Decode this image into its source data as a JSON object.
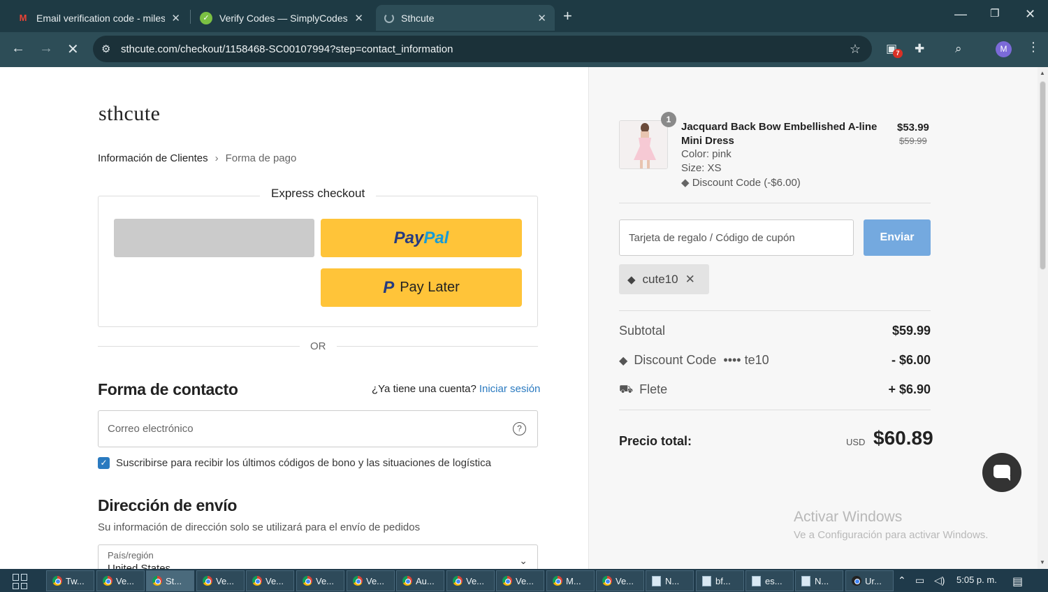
{
  "browser": {
    "tabs": [
      {
        "title": "Email verification code - milesm",
        "favicon": "gmail-icon"
      },
      {
        "title": "Verify Codes — SimplyCodes",
        "favicon": "simplycodes-icon"
      },
      {
        "title": "Sthcute",
        "favicon": "loading-icon",
        "active": true
      }
    ],
    "url": "sthcute.com/checkout/1158468-SC00107994?step=contact_information",
    "ext_badge": "7",
    "profile_initial": "M"
  },
  "checkout": {
    "logo": "sthcute",
    "breadcrumb": [
      "Información de Clientes",
      "Forma de pago"
    ],
    "express_title": "Express checkout",
    "paypal_label_a": "Pay",
    "paypal_label_b": "Pal",
    "paylater_icon": "P",
    "paylater_label": "Pay Later",
    "or": "OR",
    "contact_title": "Forma de contacto",
    "account_question": "¿Ya tiene una cuenta?",
    "login_link": "Iniciar sesión",
    "email_placeholder": "Correo electrónico",
    "help_icon": "?",
    "newsletter_checked": true,
    "newsletter_label": "Suscribirse para recibir los últimos códigos de bono y las situaciones de logística",
    "shipping_title": "Dirección de envío",
    "shipping_sub": "Su información de dirección solo se utilizará para el envío de pedidos",
    "country_label": "País/región",
    "country_value": "United States"
  },
  "summary": {
    "quantity": "1",
    "product_name": "Jacquard Back Bow Embellished A-line Mini Dress",
    "color": "Color: pink",
    "size": "Size: XS",
    "discount_line": "Discount Code (-$6.00)",
    "price": "$53.99",
    "price_old": "$59.99",
    "coupon_placeholder": "Tarjeta de regalo / Código de cupón",
    "send_label": "Enviar",
    "applied_code": "cute10",
    "subtotal_label": "Subtotal",
    "subtotal_value": "$59.99",
    "discount_label": "Discount Code",
    "discount_code_masked": "•••• te10",
    "discount_value": "- $6.00",
    "shipping_label": "Flete",
    "shipping_value": "+ $6.90",
    "total_label": "Precio total:",
    "currency": "USD",
    "total_value": "$60.89"
  },
  "watermark": {
    "line1": "Activar Windows",
    "line2": "Ve a Configuración para activar Windows."
  },
  "taskbar": {
    "items": [
      {
        "label": "Tw...",
        "type": "chrome"
      },
      {
        "label": "Ve...",
        "type": "chrome"
      },
      {
        "label": "St...",
        "type": "chrome",
        "active": true
      },
      {
        "label": "Ve...",
        "type": "chrome"
      },
      {
        "label": "Ve...",
        "type": "chrome"
      },
      {
        "label": "Ve...",
        "type": "chrome"
      },
      {
        "label": "Ve...",
        "type": "chrome"
      },
      {
        "label": "Au...",
        "type": "chrome"
      },
      {
        "label": "Ve...",
        "type": "chrome"
      },
      {
        "label": "Ve...",
        "type": "chrome"
      },
      {
        "label": "M...",
        "type": "chrome"
      },
      {
        "label": "Ve...",
        "type": "chrome"
      },
      {
        "label": "N...",
        "type": "notepad"
      },
      {
        "label": "bf...",
        "type": "notepad"
      },
      {
        "label": "es...",
        "type": "notepad"
      },
      {
        "label": "N...",
        "type": "notepad"
      },
      {
        "label": "Ur...",
        "type": "app"
      }
    ],
    "clock": "5:05 p. m."
  }
}
